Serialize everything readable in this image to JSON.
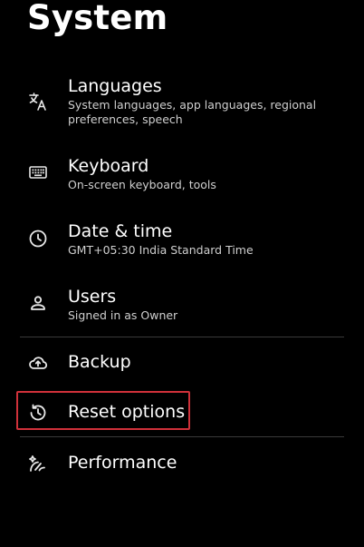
{
  "header": {
    "title": "System"
  },
  "items": [
    {
      "title": "Languages",
      "subtitle": "System languages, app languages, regional preferences, speech",
      "icon": "translate-icon"
    },
    {
      "title": "Keyboard",
      "subtitle": "On-screen keyboard, tools",
      "icon": "keyboard-icon"
    },
    {
      "title": "Date & time",
      "subtitle": "GMT+05:30 India Standard Time",
      "icon": "clock-icon"
    },
    {
      "title": "Users",
      "subtitle": "Signed in as Owner",
      "icon": "person-icon"
    },
    {
      "title": "Backup",
      "subtitle": "",
      "icon": "cloud-upload-icon"
    },
    {
      "title": "Reset options",
      "subtitle": "",
      "icon": "history-icon"
    },
    {
      "title": "Performance",
      "subtitle": "",
      "icon": "performance-icon"
    }
  ],
  "colors": {
    "background": "#000000",
    "text": "#ffffff",
    "subtext": "#cfcfcf",
    "highlight": "#d0313a"
  }
}
